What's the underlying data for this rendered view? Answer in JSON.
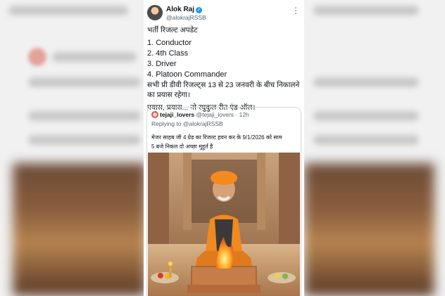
{
  "tweet": {
    "author_name": "Alok Raj",
    "author_handle": "@alokrajRSSB",
    "more_label": "⋮",
    "lines": [
      "भर्ती रिजल्ट अपडेट",
      "1. Conductor",
      "2. 4th Class",
      "3. Driver",
      "4. Platoon Commander",
      "सभी प्री डीवी रिजल्ट्स 13 से 23 जनवरी के बीच निकालने",
      "का प्रयास रहेगा।",
      "प्रयास, प्रयास... नो रघुकुल रीत एंड ऑल।"
    ]
  },
  "quoted": {
    "author_name": "tejaji_lovers",
    "author_handle": "@tejaji_lovers",
    "time": "· 12h",
    "reply_to": "Replying to @alokrajRSSB",
    "text_line1": "मेजर साहब जी 4 ग्रेड का रिजल्ट हवन कर के 9/1/2026 को साम",
    "text_line2": "5 बजे निकल दो अच्छा मुहूर्त है"
  },
  "colors": {
    "text": "#0f1419",
    "secondary": "#536471",
    "verified": "#1d9bf0",
    "border": "#cfd9de"
  },
  "icons": {
    "verified": "verified-badge-icon",
    "more": "more-options-icon"
  }
}
